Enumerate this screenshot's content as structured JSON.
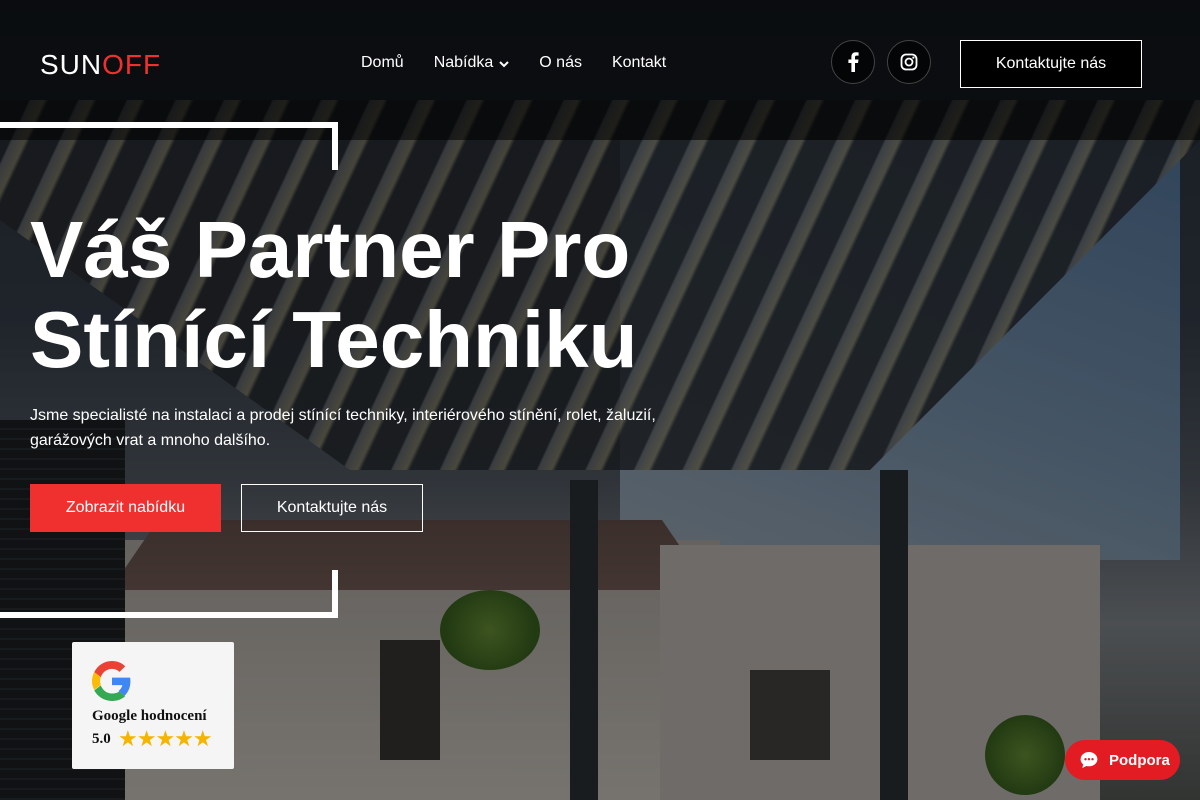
{
  "brand": {
    "logo_prefix": "SUN",
    "logo_o": "O",
    "logo_suffix": "FF",
    "accent": "#f0302e"
  },
  "nav": {
    "items": [
      {
        "label": "Domů"
      },
      {
        "label": "Nabídka",
        "has_dropdown": true
      },
      {
        "label": "O nás"
      },
      {
        "label": "Kontakt"
      }
    ]
  },
  "social": {
    "facebook_icon": "facebook-icon",
    "instagram_icon": "instagram-icon"
  },
  "header": {
    "cta_label": "Kontaktujte nás"
  },
  "hero": {
    "title_line1": "Váš Partner Pro",
    "title_line2": "Stínící Techniku",
    "subtitle": "Jsme specialisté na instalaci a prodej stínící techniky, interiérového stínění, rolet, žaluzií, garážových vrat a mnoho dalšího.",
    "primary_label": "Zobrazit nabídku",
    "secondary_label": "Kontaktujte nás"
  },
  "rating": {
    "label": "Google hodnocení",
    "score": "5.0",
    "stars": "★★★★★",
    "star_color": "#f4b400"
  },
  "support": {
    "label": "Podpora",
    "color": "#e31b23"
  }
}
